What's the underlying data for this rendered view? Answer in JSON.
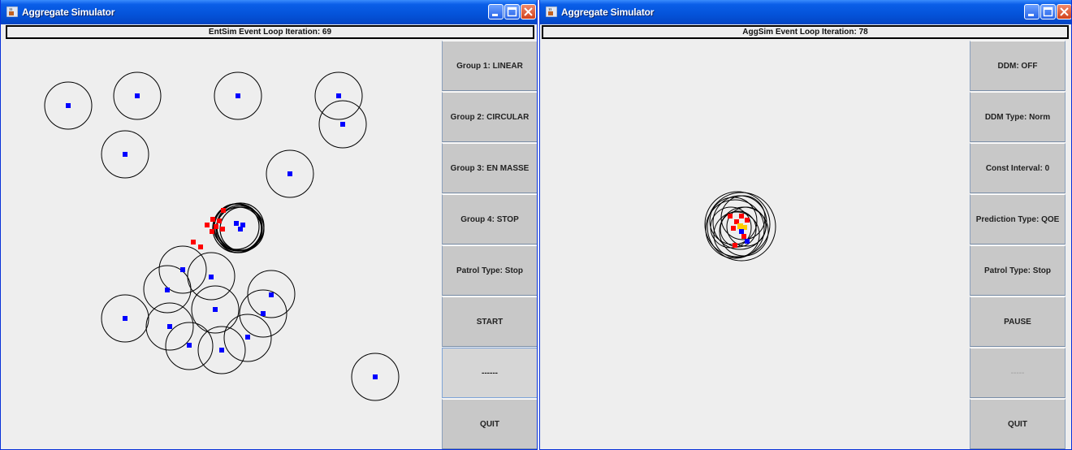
{
  "windows": [
    {
      "id": "entsim",
      "title": "Aggregate Simulator",
      "status": "EntSim Event Loop Iteration: 69",
      "buttons": [
        "Group 1: LINEAR",
        "Group 2: CIRCULAR",
        "Group 3: EN MASSE",
        "Group 4: STOP",
        "Patrol Type: Stop",
        "START",
        "------",
        "QUIT"
      ]
    },
    {
      "id": "aggsim",
      "title": "Aggregate Simulator",
      "status": "AggSim Event Loop Iteration: 78",
      "buttons": [
        "DDM: OFF",
        "DDM Type: Norm",
        "Const Interval: 0",
        "Prediction Type: QOE",
        "Patrol Type: Stop",
        "PAUSE",
        "-----",
        "QUIT"
      ]
    }
  ],
  "colors": {
    "blue_entity": "#0000ff",
    "red_entity": "#ff0000",
    "yellow_entity": "#ffcc00",
    "titlebar": "#0453d9",
    "canvas": "#eeeeee",
    "button": "#c8c8c8"
  },
  "icons": [
    "java-cup-icon",
    "minimize-icon",
    "maximize-icon",
    "close-icon"
  ]
}
